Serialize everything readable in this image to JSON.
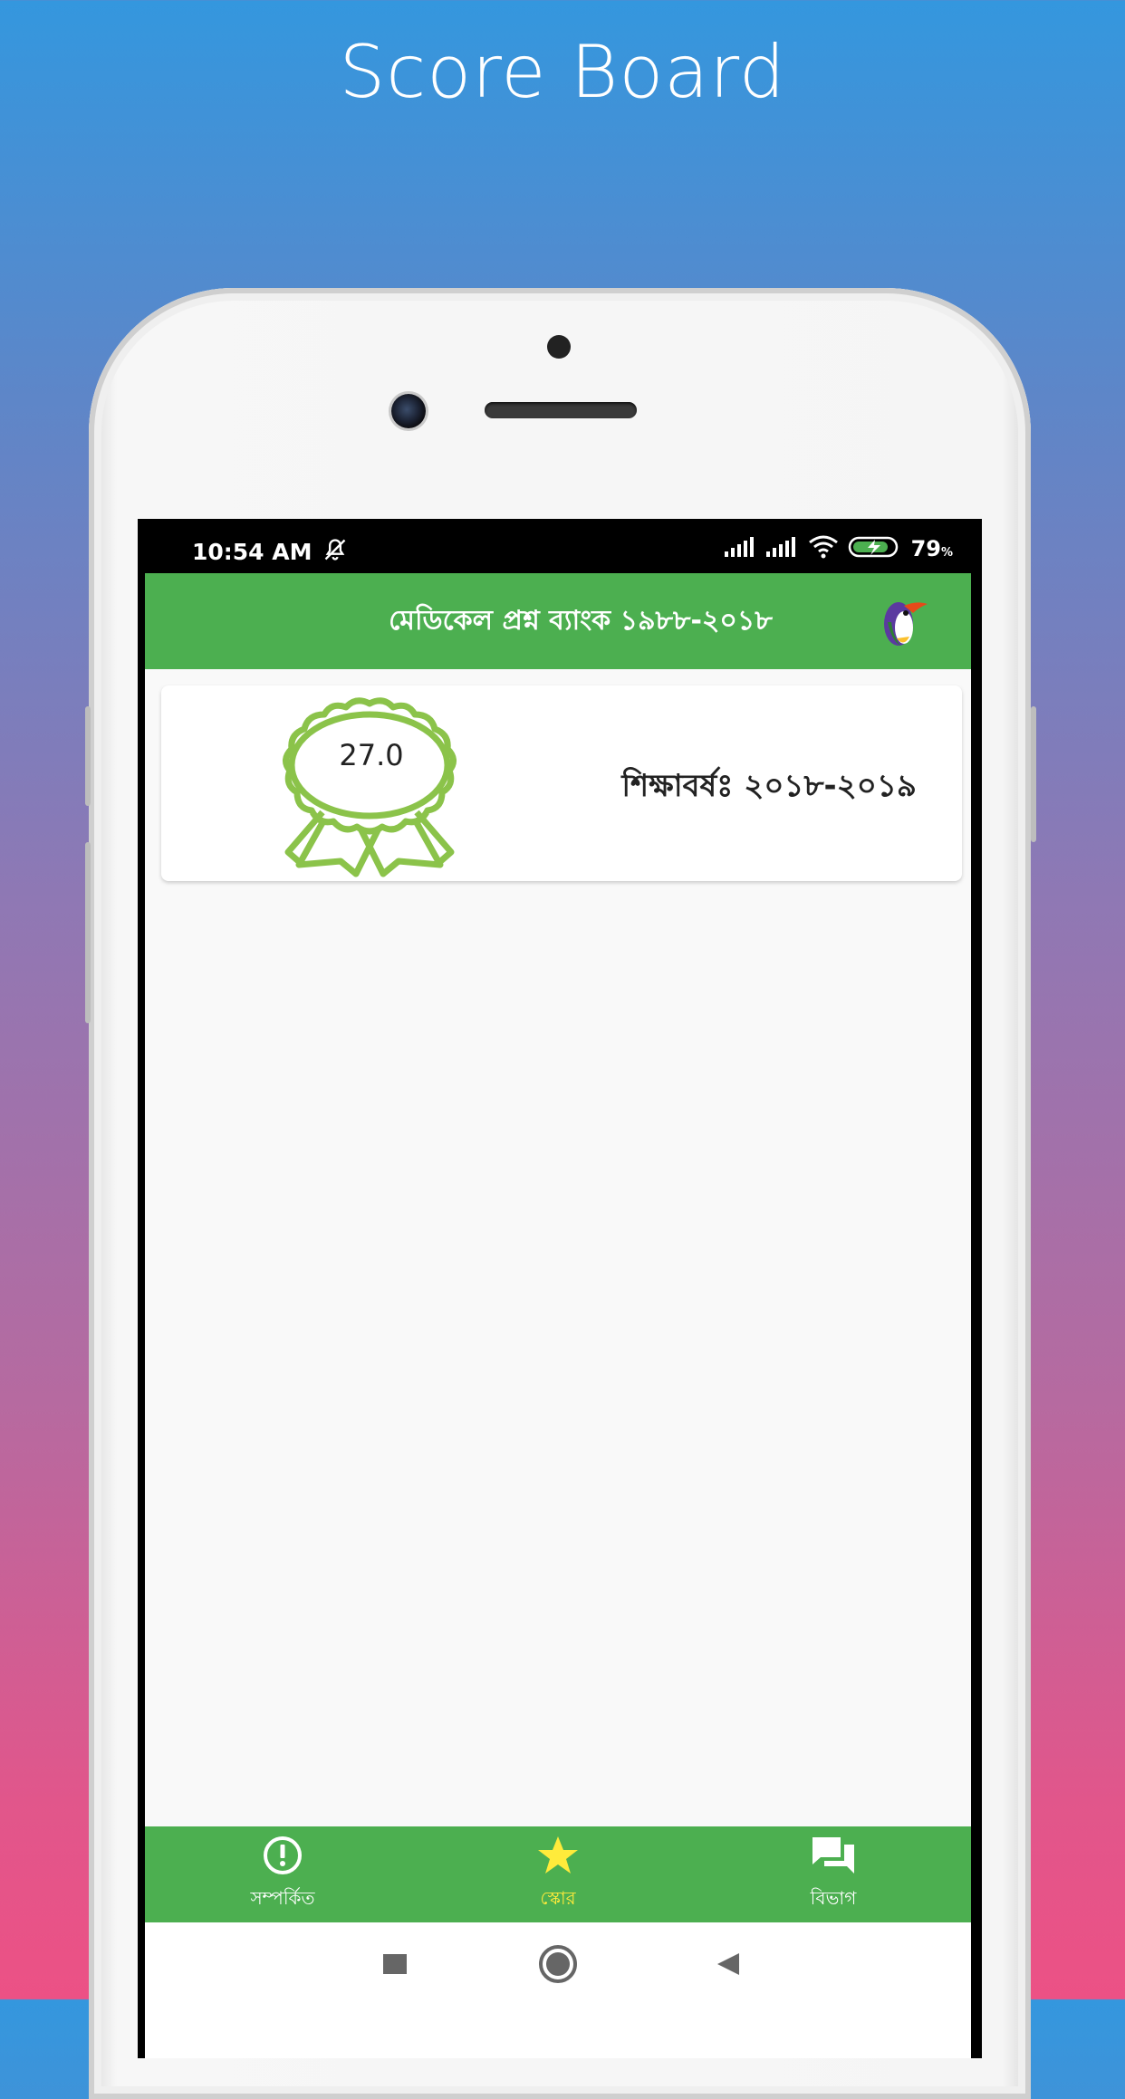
{
  "promo": {
    "title": "Score Board"
  },
  "status_bar": {
    "time": "10:54 AM",
    "battery": "79",
    "battery_unit": "%"
  },
  "app_bar": {
    "title": "মেডিকেল প্রশ্ন ব্যাংক ১৯৮৮-২০১৮",
    "logo_icon": "penguin-logo-icon"
  },
  "score_card": {
    "score": "27.0",
    "session": "শিক্ষাবর্ষঃ ২০১৮-২০১৯",
    "badge_icon": "award-ribbon-icon"
  },
  "bottom_nav": {
    "items": [
      {
        "label": "সম্পর্কিত",
        "icon": "info-icon",
        "active": false
      },
      {
        "label": "স্কোর",
        "icon": "star-icon",
        "active": true
      },
      {
        "label": "বিভাগ",
        "icon": "chat-icon",
        "active": false
      }
    ]
  },
  "colors": {
    "accent": "#4caf50",
    "active_nav": "#ffeb3b",
    "badge": "#8bc34a"
  }
}
